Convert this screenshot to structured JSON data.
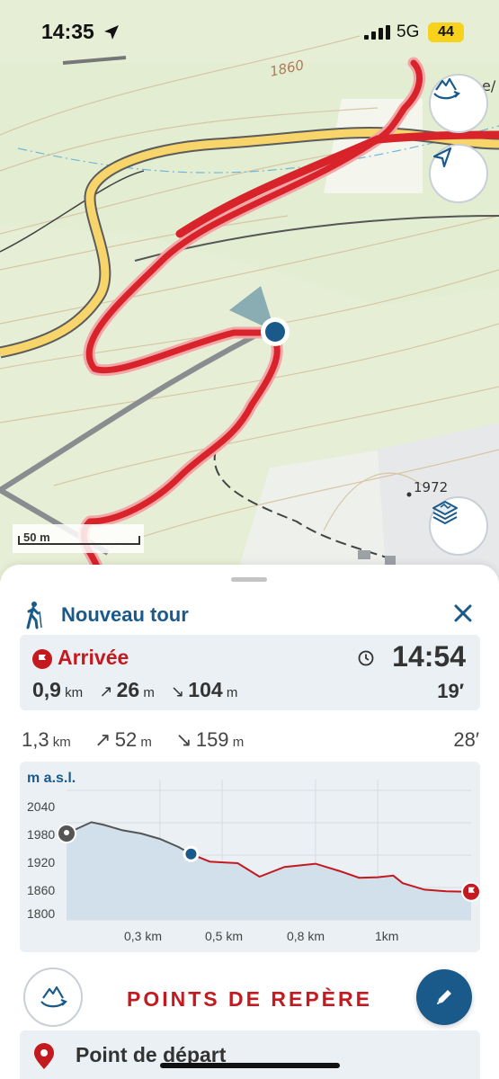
{
  "status_bar": {
    "time": "14:35",
    "network": "5G",
    "battery": "44"
  },
  "map": {
    "contour_label": "1860",
    "peak_label": "1972",
    "scale_label": "50 m",
    "edge_fragment": "e/"
  },
  "tour": {
    "title": "Nouveau tour",
    "arrival": {
      "label": "Arrivée",
      "distance": "0,9",
      "distance_unit": "km",
      "ascent": "26",
      "ascent_unit": "m",
      "descent": "104",
      "descent_unit": "m",
      "time": "14:54",
      "duration": "19′"
    },
    "totals": {
      "distance": "1,3",
      "distance_unit": "km",
      "ascent": "52",
      "ascent_unit": "m",
      "descent": "159",
      "descent_unit": "m",
      "duration": "28′"
    }
  },
  "elevation_profile": {
    "label": "m a.s.l.",
    "y_ticks": [
      "2040",
      "1980",
      "1920",
      "1860",
      "1800"
    ],
    "x_ticks": [
      "0,3 km",
      "0,5 km",
      "0,8 km",
      "1km"
    ]
  },
  "chart_data": {
    "type": "area",
    "title": "",
    "ylabel": "m a.s.l.",
    "xlabel": "",
    "ylim": [
      1800,
      2060
    ],
    "xlim": [
      0,
      1.3
    ],
    "grid": true,
    "current_position_km": 0.4,
    "x": [
      0,
      0.08,
      0.12,
      0.18,
      0.24,
      0.3,
      0.36,
      0.4,
      0.46,
      0.55,
      0.62,
      0.7,
      0.8,
      0.88,
      0.94,
      1.0,
      1.05,
      1.08,
      1.15,
      1.22,
      1.3
    ],
    "series": [
      {
        "values": [
          1960,
          1981,
          1976,
          1966,
          1960,
          1950,
          1935,
          1922,
          1908,
          1905,
          1880,
          1898,
          1904,
          1890,
          1878,
          1879,
          1882,
          1868,
          1856,
          1853,
          1852
        ]
      }
    ]
  },
  "waypoints": {
    "title": "POINTS DE REPÈRE",
    "start_label": "Point de départ"
  },
  "colors": {
    "brand_blue": "#1a5a8a",
    "accent_red": "#c4191f",
    "card_bg": "#eaf0f3",
    "route_red": "#d8232a"
  }
}
